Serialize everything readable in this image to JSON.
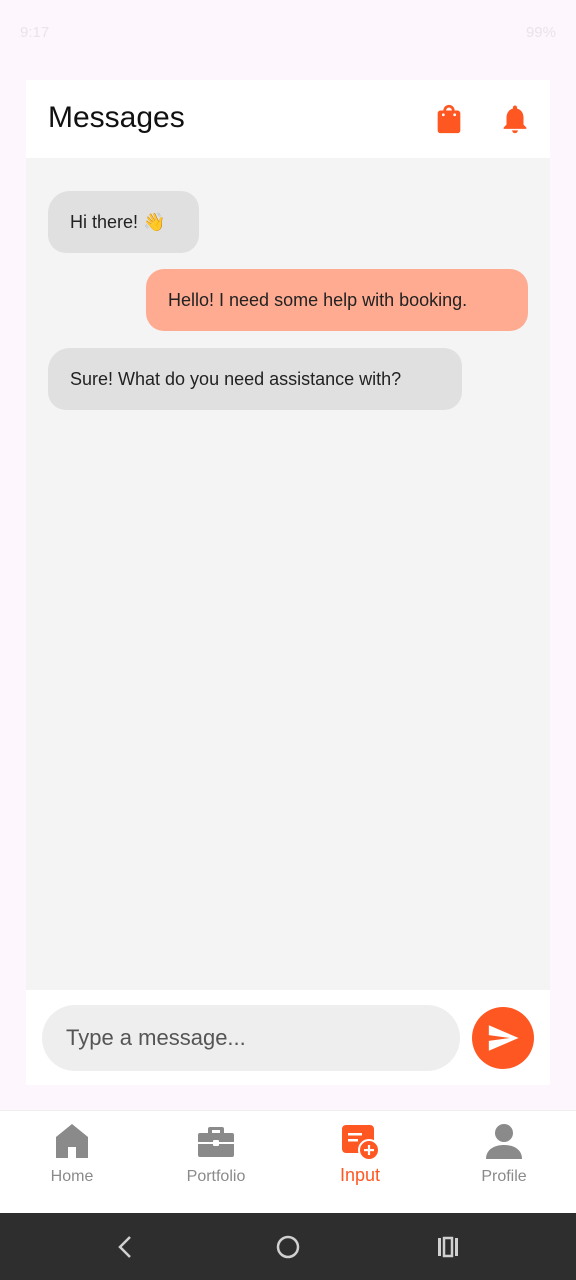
{
  "status_bar": {
    "time": "9:17",
    "battery": "99%"
  },
  "header": {
    "title": "Messages",
    "icons": [
      "shopping-bag-icon",
      "bell-icon"
    ],
    "accent_color": "#ff5722"
  },
  "messages": [
    {
      "sender": "other",
      "text": "Hi there! 👋"
    },
    {
      "sender": "me",
      "text": "Hello! I need some help with booking."
    },
    {
      "sender": "other",
      "text": "Sure! What do you need assistance with?"
    }
  ],
  "composer": {
    "placeholder": "Type a message...",
    "value": ""
  },
  "bottom_nav": {
    "items": [
      {
        "label": "Home",
        "icon": "home-icon",
        "active": false
      },
      {
        "label": "Portfolio",
        "icon": "briefcase-icon",
        "active": false
      },
      {
        "label": "Input",
        "icon": "add-note-icon",
        "active": true
      },
      {
        "label": "Profile",
        "icon": "person-icon",
        "active": false
      }
    ]
  },
  "system_nav": [
    "back-icon",
    "home-circle-icon",
    "recents-icon"
  ]
}
